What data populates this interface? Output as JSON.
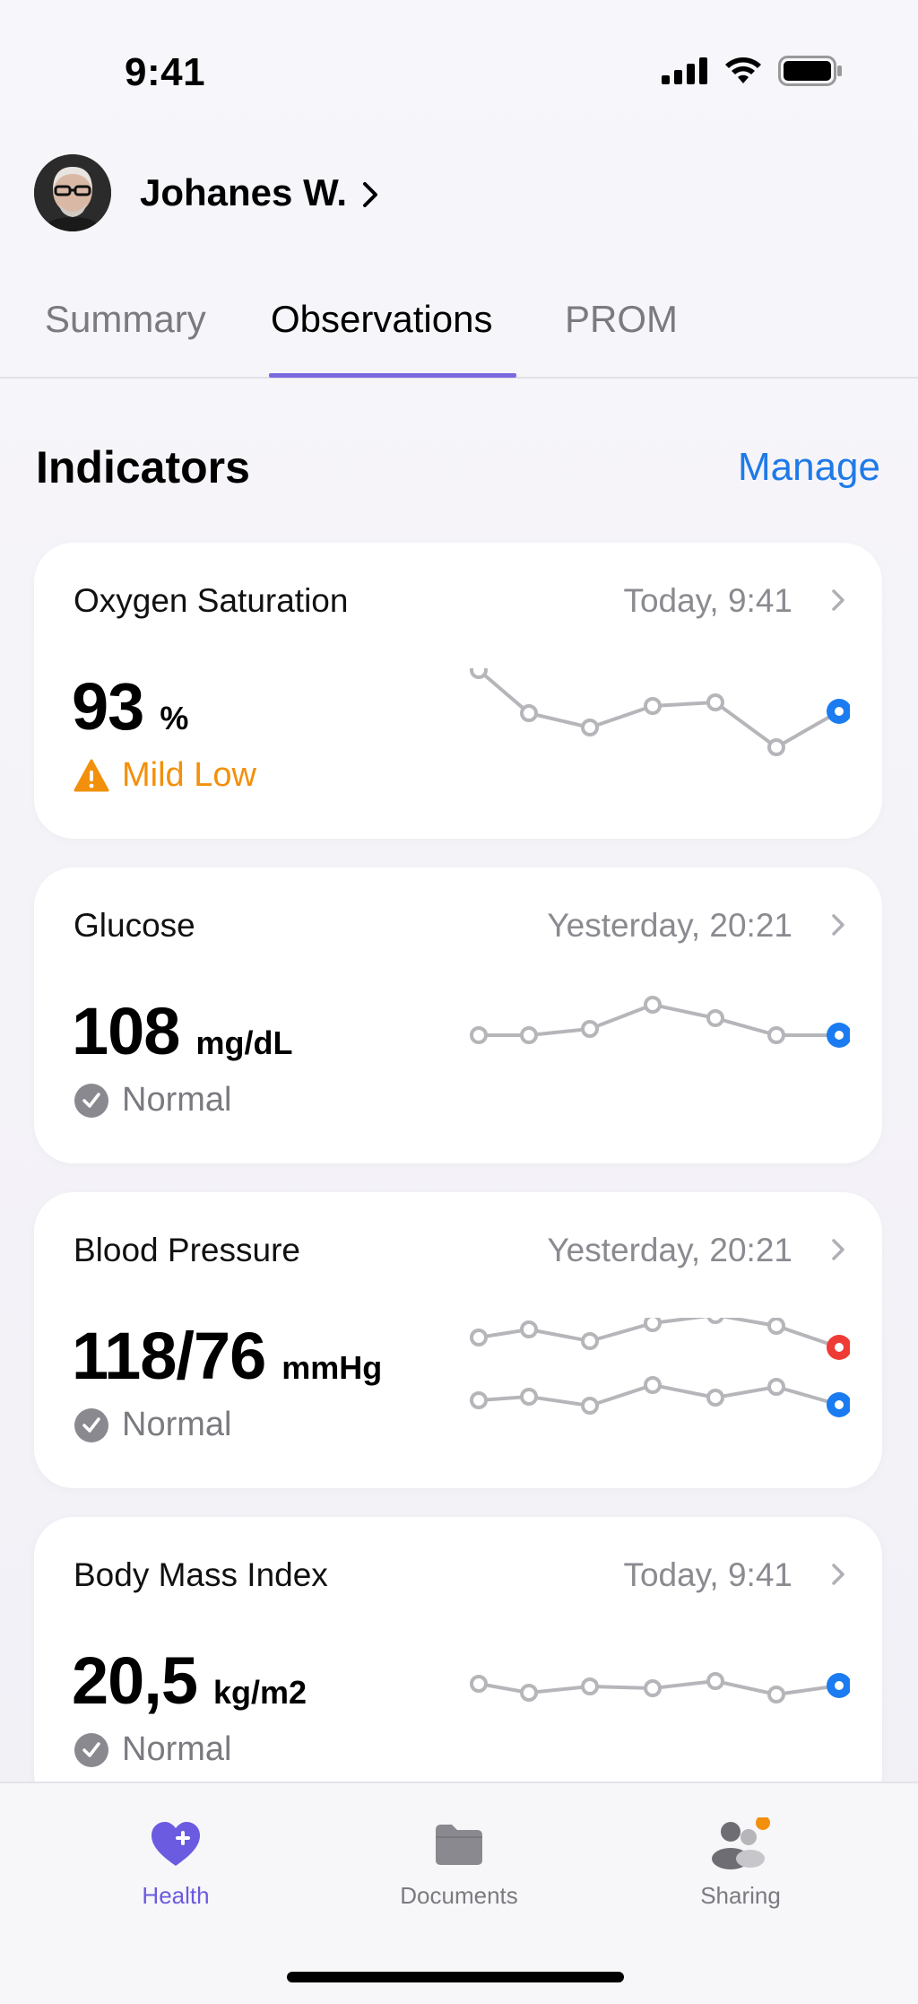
{
  "status_bar": {
    "time": "9:41"
  },
  "profile": {
    "name": "Johanes W."
  },
  "tabs": [
    {
      "label": "Summary"
    },
    {
      "label": "Observations"
    },
    {
      "label": "PROM"
    }
  ],
  "indicators": {
    "title": "Indicators",
    "manage_label": "Manage",
    "cards": [
      {
        "title": "Oxygen Saturation",
        "time": "Today, 9:41",
        "value": "93",
        "unit": "%",
        "status": "Mild Low",
        "status_type": "warning",
        "trend": [
          [
            0.85
          ],
          [
            0.5
          ],
          [
            0.38
          ],
          [
            0.58
          ],
          [
            0.62
          ],
          [
            0.28
          ],
          [
            0.55
          ]
        ]
      },
      {
        "title": "Glucose",
        "time": "Yesterday, 20:21",
        "value": "108",
        "unit": "mg/dL",
        "status": "Normal",
        "status_type": "normal"
      },
      {
        "title": "Blood Pressure",
        "time": "Yesterday, 20:21",
        "value": "118/76",
        "unit": "mmHg",
        "status": "Normal",
        "status_type": "normal"
      },
      {
        "title": "Body Mass Index",
        "time": "Today, 9:41",
        "value": "20,5",
        "unit": "kg/m2",
        "status": "Normal",
        "status_type": "normal"
      }
    ]
  },
  "tab_bar": {
    "items": [
      {
        "label": "Health",
        "icon": "heart-plus-icon"
      },
      {
        "label": "Documents",
        "icon": "folder-icon"
      },
      {
        "label": "Sharing",
        "icon": "people-icon"
      }
    ]
  },
  "colors": {
    "accent": "#6a5be0",
    "link": "#1f7ae8",
    "warning": "#f2900c",
    "latest_point": "#1a7cf0",
    "latest_point_systolic": "#ef3b36"
  }
}
